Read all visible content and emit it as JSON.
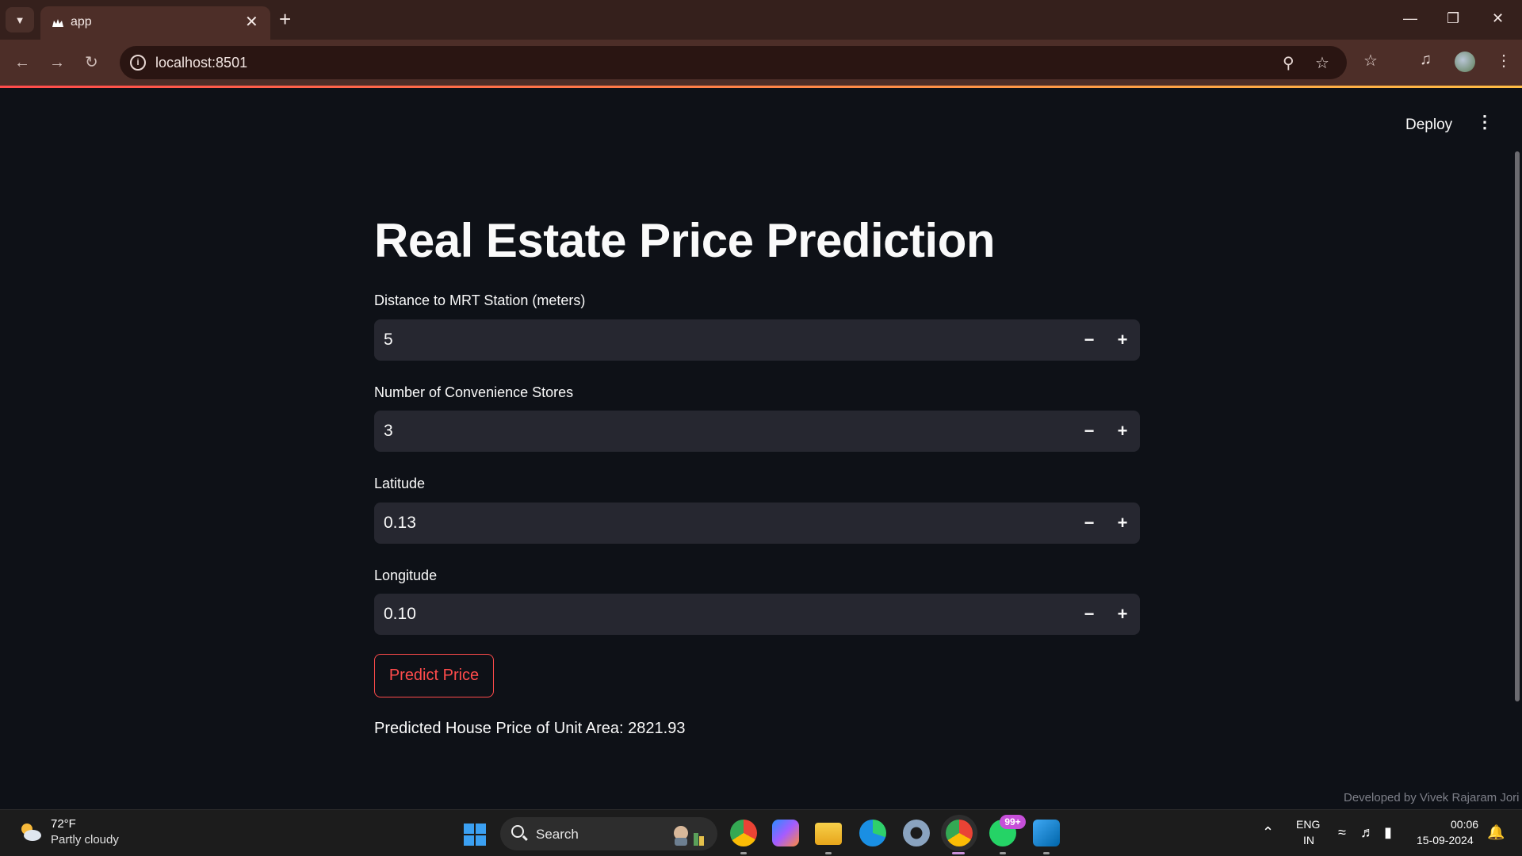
{
  "browser": {
    "tab_title": "app",
    "url": "localhost:8501",
    "colors": {
      "frame": "#35201c",
      "toolbar": "#4d2e28",
      "omnibox": "#2a1512"
    }
  },
  "app": {
    "header": {
      "deploy_label": "Deploy"
    },
    "title": "Real Estate Price Prediction",
    "fields": [
      {
        "label": "Distance to MRT Station (meters)",
        "value": "5"
      },
      {
        "label": "Number of Convenience Stores",
        "value": "3"
      },
      {
        "label": "Latitude",
        "value": "0.13"
      },
      {
        "label": "Longitude",
        "value": "0.10"
      }
    ],
    "step_minus": "−",
    "step_plus": "+",
    "predict_label": "Predict Price",
    "result_text": "Predicted House Price of Unit Area: 2821.93",
    "footer": "Developed by Vivek Rajaram Jori",
    "colors": {
      "background": "#0e1117",
      "input": "#262730",
      "accent": "#ff4b4b",
      "text": "#fafafa"
    }
  },
  "taskbar": {
    "weather": {
      "temp": "72°F",
      "desc": "Partly cloudy"
    },
    "search_label": "Search",
    "whatsapp_badge": "99+",
    "lang_top": "ENG",
    "lang_bottom": "IN",
    "time": "00:06",
    "date": "15-09-2024",
    "pinned_icons": [
      "chrome-icon",
      "copilot-icon",
      "file-explorer-icon",
      "edge-icon",
      "settings-icon",
      "chrome-active-icon",
      "whatsapp-icon",
      "vscode-icon"
    ]
  }
}
